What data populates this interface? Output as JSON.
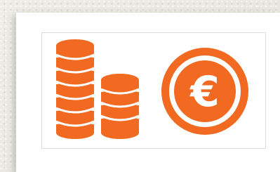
{
  "colors": {
    "accent": "#f26a21",
    "card_background": "#ffffff",
    "page_background": "#ebe9e3"
  },
  "illustration": {
    "icons": [
      "coin-stack-icon",
      "euro-coin-icon"
    ],
    "euro_symbol": "€"
  }
}
